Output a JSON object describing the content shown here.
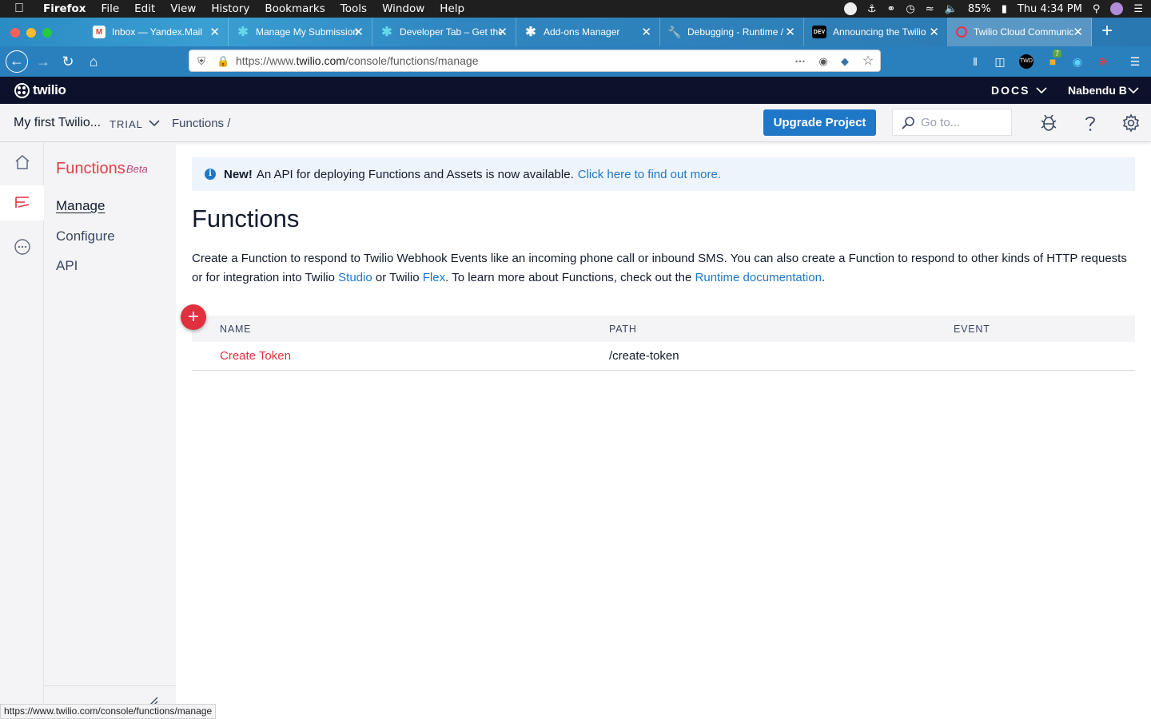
{
  "menubar": {
    "app": "Firefox",
    "items": [
      "File",
      "Edit",
      "View",
      "History",
      "Bookmarks",
      "Tools",
      "Window",
      "Help"
    ],
    "battery": "85%",
    "clock": "Thu 4:34 PM"
  },
  "tabs": [
    {
      "title": "Inbox — Yandex.Mail",
      "icon": "gmail-icon"
    },
    {
      "title": "Manage My Submissions",
      "icon": "puzzle-icon"
    },
    {
      "title": "Developer Tab – Get the",
      "icon": "puzzle-icon"
    },
    {
      "title": "Add-ons Manager",
      "icon": "puzzle-icon"
    },
    {
      "title": "Debugging - Runtime /",
      "icon": "wrench-icon"
    },
    {
      "title": "Announcing the Twilio",
      "icon": "dev-icon"
    },
    {
      "title": "Twilio Cloud Communic",
      "icon": "twilio-icon"
    }
  ],
  "navbar": {
    "url_prefix": "https://www.",
    "url_domain": "twilio.com",
    "url_path": "/console/functions/manage",
    "badge_count": "7"
  },
  "header": {
    "brand": "twilio",
    "docs": "DOCS",
    "user": "Nabendu B"
  },
  "projectbar": {
    "project": "My first Twilio...",
    "plan": "TRIAL",
    "breadcrumb": "Functions",
    "breadcrumb_sep": "/",
    "upgrade": "Upgrade Project",
    "search_placeholder": "Go to..."
  },
  "subnav": {
    "title": "Functions",
    "badge": "Beta",
    "items": [
      "Manage",
      "Configure",
      "API"
    ]
  },
  "banner": {
    "bold": "New!",
    "text": "An API for deploying Functions and Assets is now available.",
    "link": "Click here to find out more."
  },
  "main": {
    "title": "Functions",
    "desc_1": "Create a Function to respond to Twilio Webhook Events like an incoming phone call or inbound SMS. You can also create a Function to respond to other kinds of HTTP requests or for integration into Twilio ",
    "link_studio": "Studio",
    "desc_2": " or Twilio ",
    "link_flex": "Flex",
    "desc_3": ". To learn more about Functions, check out the ",
    "link_runtime": "Runtime documentation",
    "desc_4": "."
  },
  "table": {
    "columns": [
      "NAME",
      "PATH",
      "EVENT"
    ],
    "rows": [
      {
        "name": "Create Token",
        "path": "/create-token",
        "event": ""
      }
    ]
  },
  "status_url": "https://www.twilio.com/console/functions/manage"
}
